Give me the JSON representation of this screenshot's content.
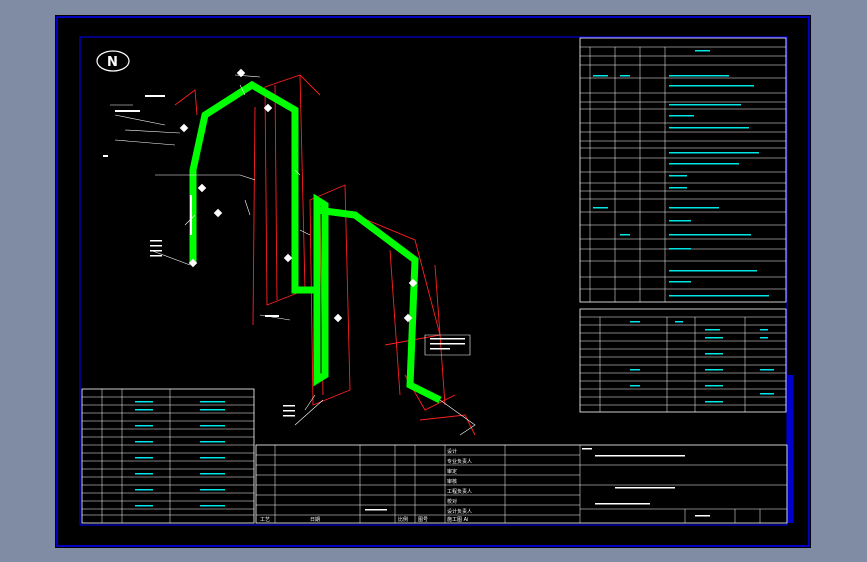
{
  "drawing": {
    "north_label": "N",
    "title_block": {
      "cells": [
        "设计",
        "专业负责人",
        "审定",
        "审核",
        "工程负责人",
        "校对",
        "设计负责人",
        "施工图 Ai"
      ],
      "bottom_labels": [
        "工艺",
        "日期",
        "比例",
        "图号"
      ]
    },
    "colors": {
      "background": "#000000",
      "frame": "#0000ff",
      "pipe": "#00ff00",
      "support": "#ff2020",
      "annotation": "#ffffff",
      "table_text": "#00e5e5",
      "side_strip": "#0000cc",
      "outer": "#7f8ca4"
    }
  }
}
